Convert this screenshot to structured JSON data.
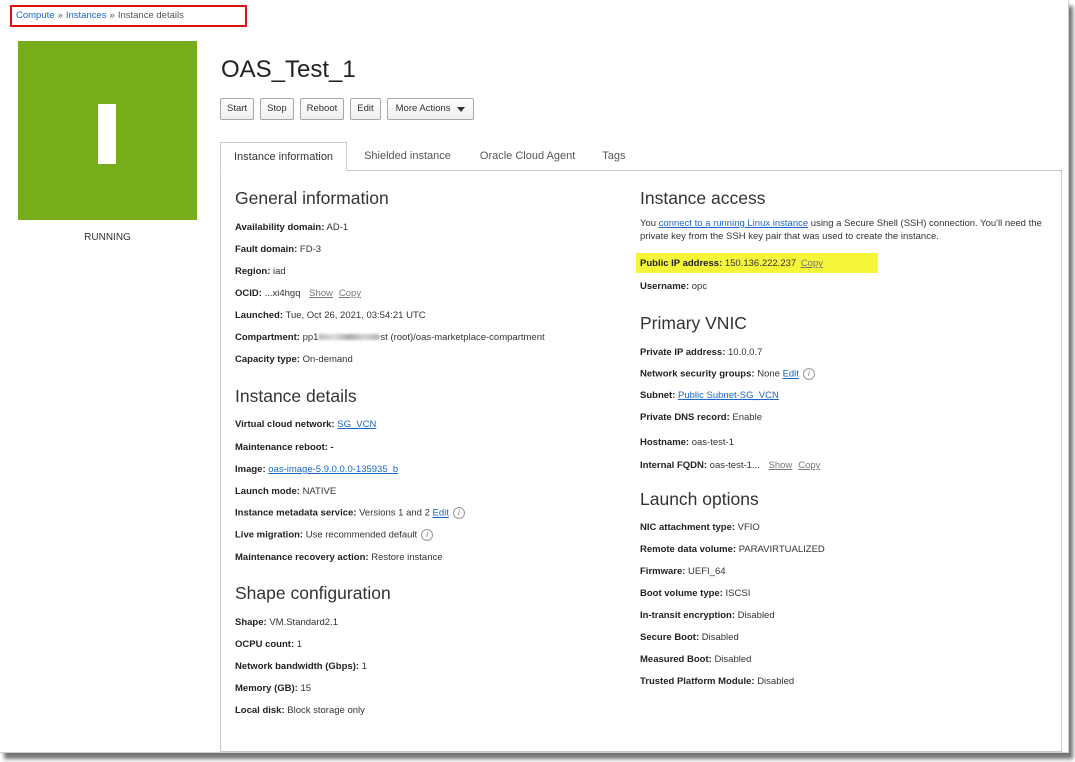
{
  "breadcrumb": {
    "items": [
      "Compute",
      "Instances",
      "Instance details"
    ],
    "separator": "»"
  },
  "status": {
    "label": "RUNNING",
    "color": "#78ad1a"
  },
  "title": "OAS_Test_1",
  "actions": [
    "Start",
    "Stop",
    "Reboot",
    "Edit",
    "More Actions"
  ],
  "tabs": [
    "Instance information",
    "Shielded instance",
    "Oracle Cloud Agent",
    "Tags"
  ],
  "general": {
    "heading": "General information",
    "availability_label": "Availability domain:",
    "availability_value": "AD-1",
    "fault_label": "Fault domain:",
    "fault_value": "FD-3",
    "region_label": "Region:",
    "region_value": "iad",
    "ocid_label": "OCID:",
    "ocid_value": "...xi4hgq",
    "ocid_show": "Show",
    "ocid_copy": "Copy",
    "launched_label": "Launched:",
    "launched_value": "Tue, Oct 26, 2021, 03:54:21 UTC",
    "compartment_label": "Compartment:",
    "compartment_prefix": "pp1",
    "compartment_suffix": "st (root)/oas-marketplace-compartment",
    "capacity_label": "Capacity type:",
    "capacity_value": "On-demand"
  },
  "details": {
    "heading": "Instance details",
    "vcn_label": "Virtual cloud network:",
    "vcn_value": "SG_VCN",
    "reboot_label": "Maintenance reboot:",
    "reboot_value": "-",
    "image_label": "Image:",
    "image_value": "oas-image-5.9.0.0.0-135935_b",
    "launch_mode_label": "Launch mode:",
    "launch_mode_value": "NATIVE",
    "metadata_label": "Instance metadata service:",
    "metadata_value": "Versions 1 and 2",
    "metadata_edit": "Edit",
    "migration_label": "Live migration:",
    "migration_value": "Use recommended default",
    "recovery_label": "Maintenance recovery action:",
    "recovery_value": "Restore instance"
  },
  "shape": {
    "heading": "Shape configuration",
    "shape_label": "Shape:",
    "shape_value": "VM.Standard2.1",
    "ocpu_label": "OCPU count:",
    "ocpu_value": "1",
    "bandwidth_label": "Network bandwidth (Gbps):",
    "bandwidth_value": "1",
    "memory_label": "Memory (GB):",
    "memory_value": "15",
    "disk_label": "Local disk:",
    "disk_value": "Block storage only"
  },
  "access": {
    "heading": "Instance access",
    "text_before": "You ",
    "link": "connect to a running Linux instance",
    "text_after": " using a Secure Shell (SSH) connection. You'll need the private key from the SSH key pair that was used to create the instance.",
    "public_ip_label": "Public IP address:",
    "public_ip_value": "150.136.222.237",
    "public_ip_copy": "Copy",
    "username_label": "Username:",
    "username_value": "opc",
    "highlight_color": "#f5f53a"
  },
  "vnic": {
    "heading": "Primary VNIC",
    "private_ip_label": "Private IP address:",
    "private_ip_value": "10.0.0.7",
    "nsg_label": "Network security groups:",
    "nsg_value": "None",
    "nsg_edit": "Edit",
    "subnet_label": "Subnet:",
    "subnet_value": "Public Subnet-SG_VCN",
    "dns_label": "Private DNS record:",
    "dns_value": "Enable",
    "hostname_label": "Hostname:",
    "hostname_value": "oas-test-1",
    "fqdn_label": "Internal FQDN:",
    "fqdn_value": "oas-test-1...",
    "fqdn_show": "Show",
    "fqdn_copy": "Copy"
  },
  "launch": {
    "heading": "Launch options",
    "nic_label": "NIC attachment type:",
    "nic_value": "VFIO",
    "remote_label": "Remote data volume:",
    "remote_value": "PARAVIRTUALIZED",
    "firmware_label": "Firmware:",
    "firmware_value": "UEFI_64",
    "boot_label": "Boot volume type:",
    "boot_value": "ISCSI",
    "encryption_label": "In-transit encryption:",
    "encryption_value": "Disabled",
    "secure_label": "Secure Boot:",
    "secure_value": "Disabled",
    "measured_label": "Measured Boot:",
    "measured_value": "Disabled",
    "tpm_label": "Trusted Platform Module:",
    "tpm_value": "Disabled"
  },
  "colors": {
    "link": "#1a66c9",
    "breadcrumb_box": "#e01010"
  },
  "icons": [
    "info-icon",
    "caret-down-icon"
  ]
}
